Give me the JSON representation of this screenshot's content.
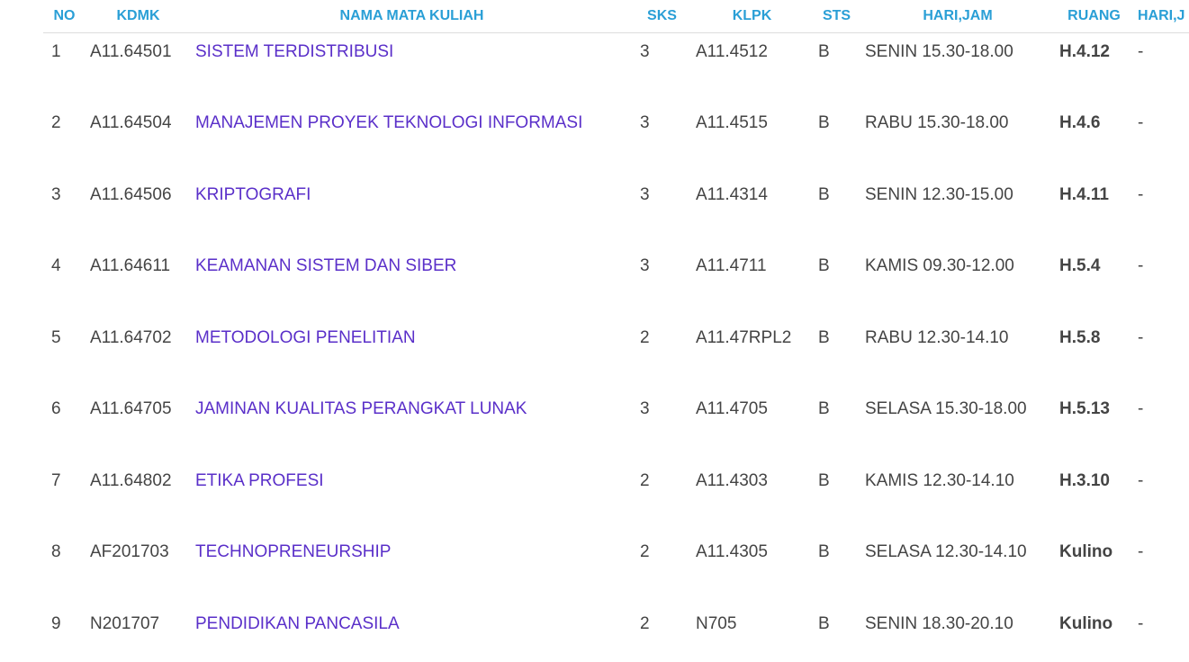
{
  "columns": {
    "no": "NO",
    "kdmk": "KDMK",
    "nama": "NAMA MATA KULIAH",
    "sks": "SKS",
    "klpk": "KLPK",
    "sts": "STS",
    "hari_jam": "HARI,JAM",
    "ruang": "RUANG",
    "hari_jam2": "HARI,J"
  },
  "rows": [
    {
      "no": "1",
      "kdmk": "A11.64501",
      "nama": "SISTEM TERDISTRIBUSI",
      "sks": "3",
      "klpk": "A11.4512",
      "sts": "B",
      "hari_jam": "SENIN 15.30-18.00",
      "ruang": "H.4.12",
      "hari_jam2": "-"
    },
    {
      "no": "2",
      "kdmk": "A11.64504",
      "nama": "MANAJEMEN PROYEK TEKNOLOGI INFORMASI",
      "sks": "3",
      "klpk": "A11.4515",
      "sts": "B",
      "hari_jam": "RABU 15.30-18.00",
      "ruang": "H.4.6",
      "hari_jam2": "-"
    },
    {
      "no": "3",
      "kdmk": "A11.64506",
      "nama": "KRIPTOGRAFI",
      "sks": "3",
      "klpk": "A11.4314",
      "sts": "B",
      "hari_jam": "SENIN 12.30-15.00",
      "ruang": "H.4.11",
      "hari_jam2": "-"
    },
    {
      "no": "4",
      "kdmk": "A11.64611",
      "nama": "KEAMANAN SISTEM DAN SIBER",
      "sks": "3",
      "klpk": "A11.4711",
      "sts": "B",
      "hari_jam": "KAMIS 09.30-12.00",
      "ruang": "H.5.4",
      "hari_jam2": "-"
    },
    {
      "no": "5",
      "kdmk": "A11.64702",
      "nama": "METODOLOGI PENELITIAN",
      "sks": "2",
      "klpk": "A11.47RPL2",
      "sts": "B",
      "hari_jam": "RABU 12.30-14.10",
      "ruang": "H.5.8",
      "hari_jam2": "-"
    },
    {
      "no": "6",
      "kdmk": "A11.64705",
      "nama": "JAMINAN KUALITAS PERANGKAT LUNAK",
      "sks": "3",
      "klpk": "A11.4705",
      "sts": "B",
      "hari_jam": "SELASA 15.30-18.00",
      "ruang": "H.5.13",
      "hari_jam2": "-"
    },
    {
      "no": "7",
      "kdmk": "A11.64802",
      "nama": "ETIKA PROFESI",
      "sks": "2",
      "klpk": "A11.4303",
      "sts": "B",
      "hari_jam": "KAMIS 12.30-14.10",
      "ruang": "H.3.10",
      "hari_jam2": "-"
    },
    {
      "no": "8",
      "kdmk": "AF201703",
      "nama": "TECHNOPRENEURSHIP",
      "sks": "2",
      "klpk": "A11.4305",
      "sts": "B",
      "hari_jam": "SELASA 12.30-14.10",
      "ruang": "Kulino",
      "hari_jam2": "-"
    },
    {
      "no": "9",
      "kdmk": "N201707",
      "nama": "PENDIDIKAN PANCASILA",
      "sks": "2",
      "klpk": "N705",
      "sts": "B",
      "hari_jam": "SENIN 18.30-20.10",
      "ruang": "Kulino",
      "hari_jam2": "-"
    }
  ],
  "colors": {
    "header_text": "#2a9fd6",
    "link_text": "#5a2fc9",
    "body_text": "#444444"
  }
}
